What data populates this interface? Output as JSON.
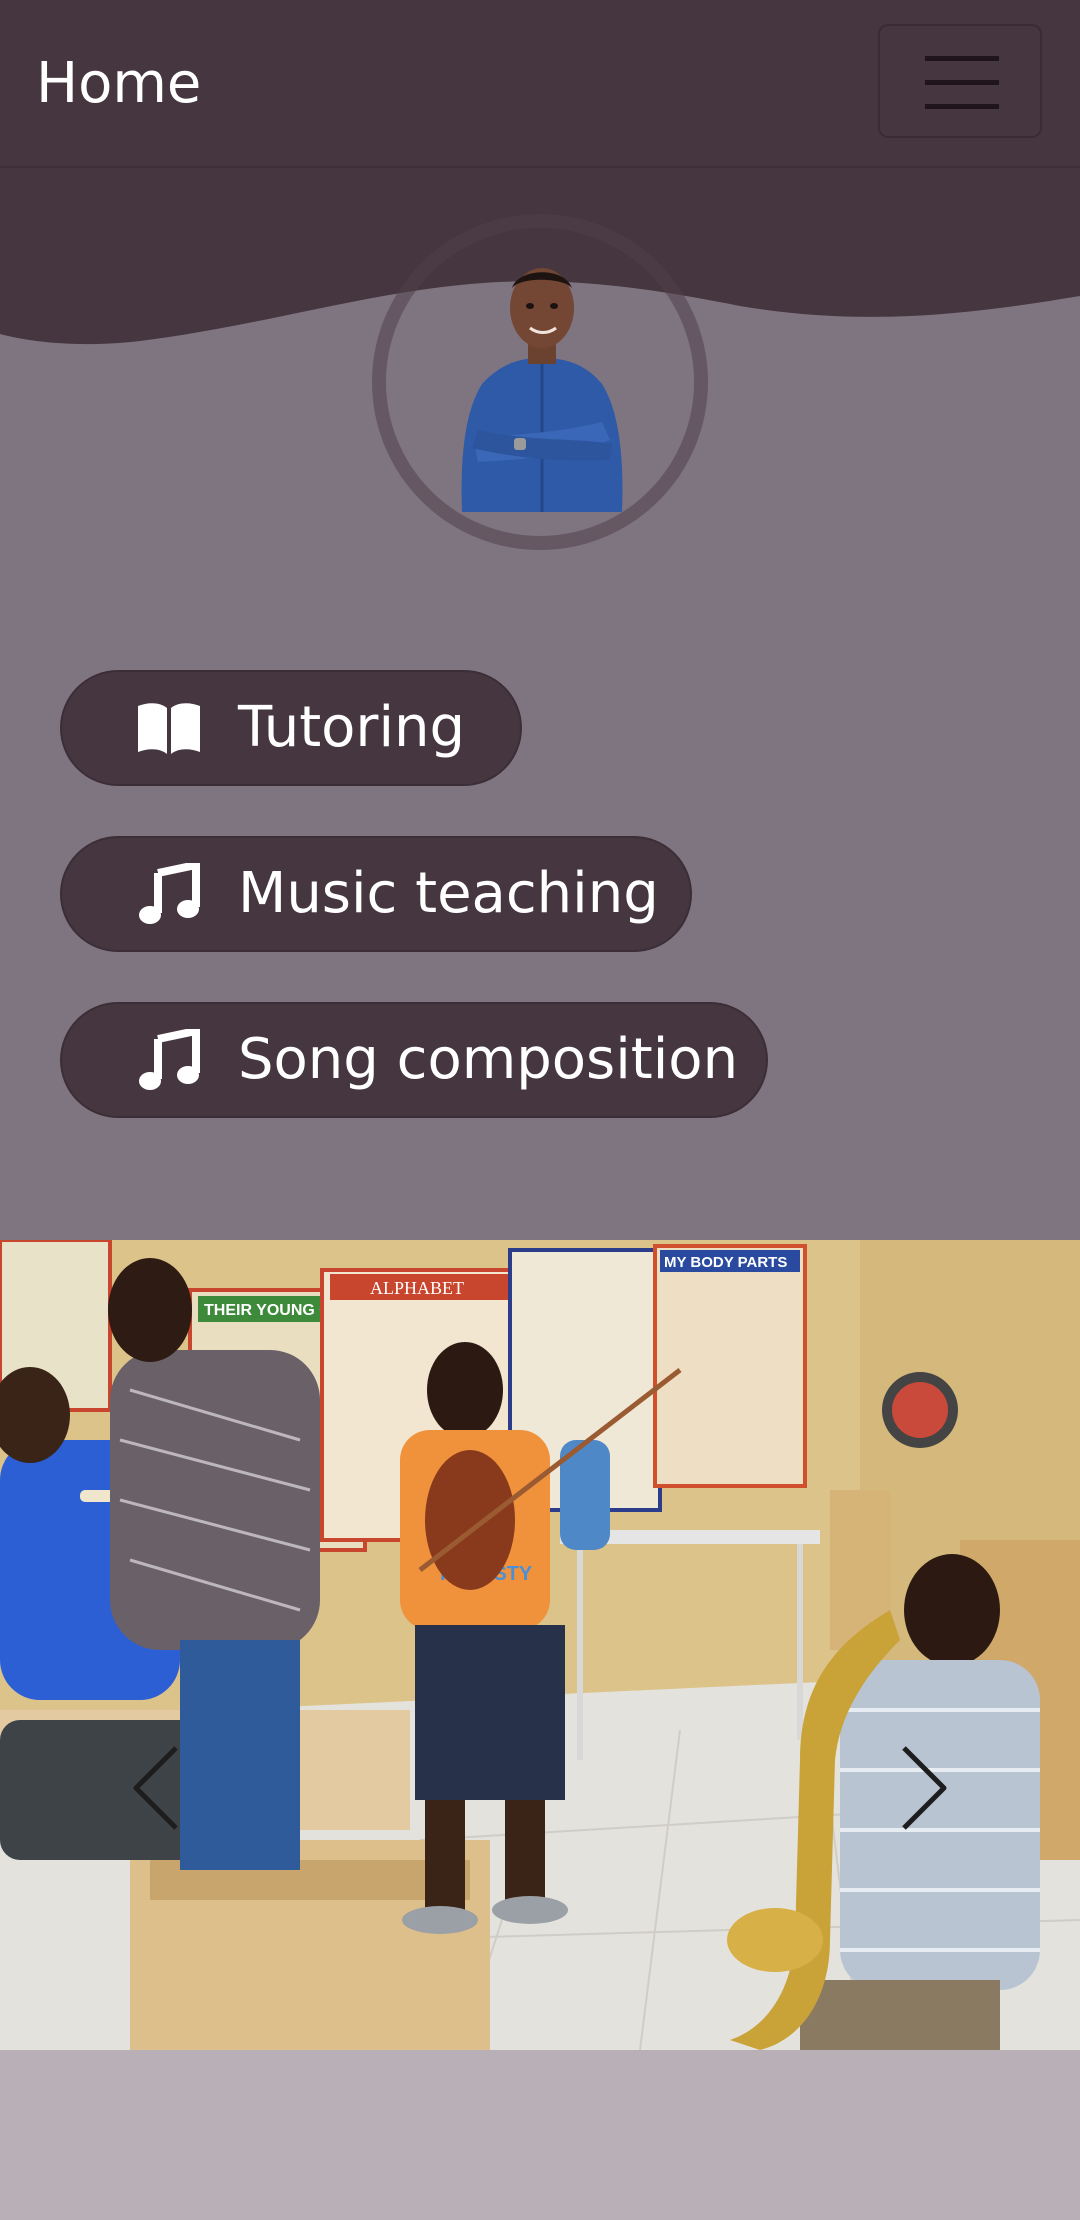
{
  "navbar": {
    "brand": "Home",
    "menu_icon": "hamburger-icon"
  },
  "profile": {
    "avatar_icon": "profile-photo"
  },
  "services": [
    {
      "label": "Tutoring",
      "icon": "open-book-icon"
    },
    {
      "label": "Music teaching",
      "icon": "music-note-icon"
    },
    {
      "label": "Song composition",
      "icon": "music-note-icon"
    }
  ],
  "carousel": {
    "prev_icon": "chevron-left-icon",
    "next_icon": "chevron-right-icon",
    "slide_labels": {
      "poster_1": "THEIR YOUNG ONES",
      "poster_2": "ALPHABET",
      "poster_3": "MY BODY PARTS",
      "shirt": "FREESTY"
    }
  },
  "colors": {
    "navbar_bg": "#45363f",
    "hero_bg": "#7f7580",
    "page_bg": "#b8b0b6",
    "pill_bg": "#45363f",
    "text_light": "#ffffff"
  }
}
